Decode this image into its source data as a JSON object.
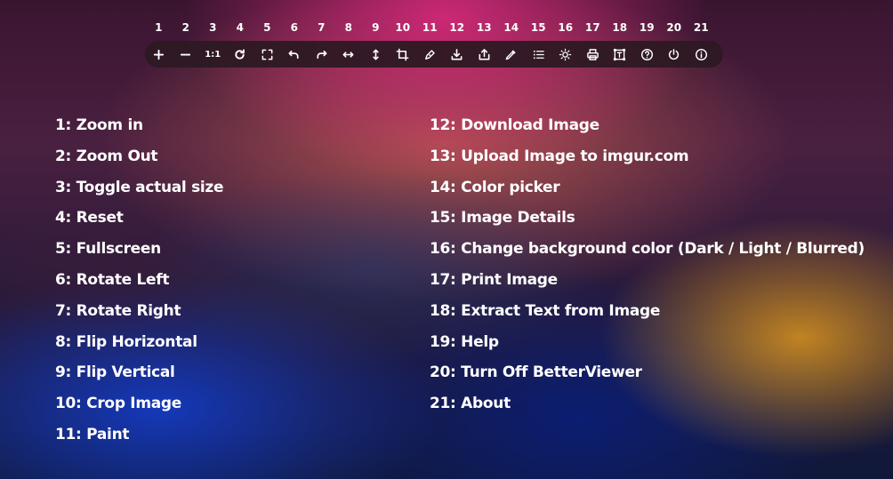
{
  "toolbar": {
    "numbers": [
      "1",
      "2",
      "3",
      "4",
      "5",
      "6",
      "7",
      "8",
      "9",
      "10",
      "11",
      "12",
      "13",
      "14",
      "15",
      "16",
      "17",
      "18",
      "19",
      "20",
      "21"
    ],
    "actual_size_label": "1:1",
    "buttons": [
      {
        "icon": "plus-icon"
      },
      {
        "icon": "minus-icon"
      },
      {
        "icon": "actual-size-icon"
      },
      {
        "icon": "reset-icon"
      },
      {
        "icon": "fullscreen-icon"
      },
      {
        "icon": "rotate-left-icon"
      },
      {
        "icon": "rotate-right-icon"
      },
      {
        "icon": "flip-horizontal-icon"
      },
      {
        "icon": "flip-vertical-icon"
      },
      {
        "icon": "crop-icon"
      },
      {
        "icon": "paint-icon"
      },
      {
        "icon": "download-icon"
      },
      {
        "icon": "upload-icon"
      },
      {
        "icon": "color-picker-icon"
      },
      {
        "icon": "list-icon"
      },
      {
        "icon": "sun-icon"
      },
      {
        "icon": "printer-icon"
      },
      {
        "icon": "extract-text-icon"
      },
      {
        "icon": "help-icon"
      },
      {
        "icon": "power-icon"
      },
      {
        "icon": "info-icon"
      }
    ]
  },
  "legend": {
    "left": [
      "1: Zoom in",
      "2: Zoom Out",
      "3: Toggle actual size",
      "4: Reset",
      "5: Fullscreen",
      "6: Rotate Left",
      "7: Rotate Right",
      "8: Flip Horizontal",
      "9: Flip Vertical",
      "10: Crop Image",
      "11: Paint"
    ],
    "right": [
      "12: Download Image",
      "13: Upload Image to imgur.com",
      "14: Color picker",
      "15: Image Details",
      "16: Change background color (Dark / Light / Blurred)",
      "17: Print Image",
      "18: Extract Text from Image",
      "19: Help",
      "20: Turn Off BetterViewer",
      "21: About"
    ]
  }
}
